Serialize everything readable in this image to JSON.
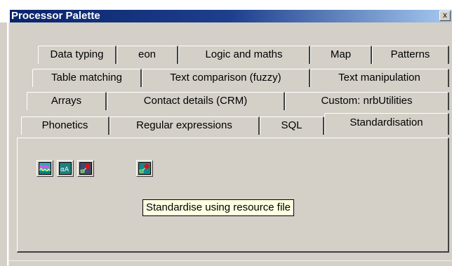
{
  "window": {
    "title": "Processor Palette",
    "close_label": "x"
  },
  "tabs": {
    "row1": [
      "Data typing",
      "eon",
      "Logic and maths",
      "Map",
      "Patterns"
    ],
    "row2": [
      "Table matching",
      "Text comparison (fuzzy)",
      "Text manipulation"
    ],
    "row3": [
      "Arrays",
      "Contact details (CRM)",
      "Custom: nrbUtilities"
    ],
    "row4": [
      "Phonetics",
      "Regular expressions",
      "SQL",
      "Standardisation"
    ],
    "active": "Standardisation"
  },
  "tools": [
    {
      "icon": "wave-chart-icon"
    },
    {
      "icon": "text-aa-icon"
    },
    {
      "icon": "red-dot-connector-icon"
    },
    {
      "icon": "red-dot-connector-icon"
    }
  ],
  "tooltip": {
    "text": "Standardise using resource file"
  },
  "colors": {
    "title_start": "#0a246a",
    "title_end": "#a6caf0",
    "face": "#d4d0c8",
    "tooltip_bg": "#ffffe1"
  }
}
